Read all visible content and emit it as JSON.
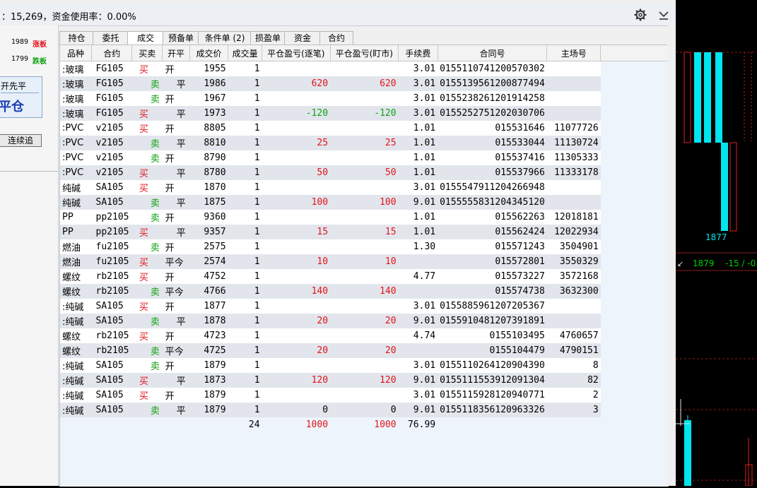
{
  "window": {
    "title": "：15,269，资金使用率：0.00%"
  },
  "chart": {
    "price_label": "1877",
    "last_price": "1879",
    "change": "-15 / -0."
  },
  "limits": {
    "up_value": "1989",
    "up_label": "涨板",
    "down_value": "1799",
    "down_label": "跌板"
  },
  "order_panel": {
    "close_first": "开先平",
    "close_position": "平仓",
    "continuous_chase": "连续追"
  },
  "tabs": [
    "持仓",
    "委托",
    "成交",
    "预备单",
    "条件单 (2)",
    "损盈单",
    "资金",
    "合约"
  ],
  "active_tab": "成交",
  "columns": [
    "品种",
    "合约",
    "买卖",
    "开平",
    "成交价",
    "成交量",
    "平仓盈亏(逐笔)",
    "平仓盈亏(盯市)",
    "手续费",
    "合同号",
    "主场号"
  ],
  "rows": [
    {
      "name": ":玻璃",
      "code": "FG105",
      "side": "买",
      "oc": "开",
      "price": "1955",
      "qty": "1",
      "pnl1": "",
      "pnl2": "",
      "fee": "3.01",
      "contract": "0155110741200570302",
      "exch": ""
    },
    {
      "name": ":玻璃",
      "code": "FG105",
      "side": "卖",
      "oc": "平",
      "price": "1986",
      "qty": "1",
      "pnl1": "620",
      "pnl2": "620",
      "fee": "3.01",
      "contract": "0155139561200877494",
      "exch": ""
    },
    {
      "name": ":玻璃",
      "code": "FG105",
      "side": "卖",
      "oc": "开",
      "price": "1967",
      "qty": "1",
      "pnl1": "",
      "pnl2": "",
      "fee": "3.01",
      "contract": "0155238261201914258",
      "exch": ""
    },
    {
      "name": ":玻璃",
      "code": "FG105",
      "side": "买",
      "oc": "平",
      "price": "1973",
      "qty": "1",
      "pnl1": "-120",
      "pnl2": "-120",
      "fee": "3.01",
      "contract": "0155252751202030706",
      "exch": ""
    },
    {
      "name": ":PVC",
      "code": "v2105",
      "side": "买",
      "oc": "开",
      "price": "8805",
      "qty": "1",
      "pnl1": "",
      "pnl2": "",
      "fee": "1.01",
      "contract": "015531646",
      "exch": "11077726"
    },
    {
      "name": ":PVC",
      "code": "v2105",
      "side": "卖",
      "oc": "平",
      "price": "8810",
      "qty": "1",
      "pnl1": "25",
      "pnl2": "25",
      "fee": "1.01",
      "contract": "015533044",
      "exch": "11130724"
    },
    {
      "name": ":PVC",
      "code": "v2105",
      "side": "卖",
      "oc": "开",
      "price": "8790",
      "qty": "1",
      "pnl1": "",
      "pnl2": "",
      "fee": "1.01",
      "contract": "015537416",
      "exch": "11305333"
    },
    {
      "name": ":PVC",
      "code": "v2105",
      "side": "买",
      "oc": "平",
      "price": "8780",
      "qty": "1",
      "pnl1": "50",
      "pnl2": "50",
      "fee": "1.01",
      "contract": "015537966",
      "exch": "11333178"
    },
    {
      "name": "纯碱",
      "code": "SA105",
      "side": "买",
      "oc": "开",
      "price": "1870",
      "qty": "1",
      "pnl1": "",
      "pnl2": "",
      "fee": "3.01",
      "contract": "0155547911204266948",
      "exch": ""
    },
    {
      "name": "纯碱",
      "code": "SA105",
      "side": "卖",
      "oc": "平",
      "price": "1875",
      "qty": "1",
      "pnl1": "100",
      "pnl2": "100",
      "fee": "9.01",
      "contract": "0155555831204345120",
      "exch": ""
    },
    {
      "name": "PP",
      "code": "pp2105",
      "side": "卖",
      "oc": "开",
      "price": "9360",
      "qty": "1",
      "pnl1": "",
      "pnl2": "",
      "fee": "1.01",
      "contract": "015562263",
      "exch": "12018181"
    },
    {
      "name": "PP",
      "code": "pp2105",
      "side": "买",
      "oc": "平",
      "price": "9357",
      "qty": "1",
      "pnl1": "15",
      "pnl2": "15",
      "fee": "1.01",
      "contract": "015562424",
      "exch": "12022934"
    },
    {
      "name": "燃油",
      "code": "fu2105",
      "side": "卖",
      "oc": "开",
      "price": "2575",
      "qty": "1",
      "pnl1": "",
      "pnl2": "",
      "fee": "1.30",
      "contract": "015571243",
      "exch": "3504901"
    },
    {
      "name": "燃油",
      "code": "fu2105",
      "side": "买",
      "oc": "平今",
      "price": "2574",
      "qty": "1",
      "pnl1": "10",
      "pnl2": "10",
      "fee": "",
      "contract": "015572801",
      "exch": "3550329"
    },
    {
      "name": "螺纹",
      "code": "rb2105",
      "side": "买",
      "oc": "开",
      "price": "4752",
      "qty": "1",
      "pnl1": "",
      "pnl2": "",
      "fee": "4.77",
      "contract": "015573227",
      "exch": "3572168"
    },
    {
      "name": "螺纹",
      "code": "rb2105",
      "side": "卖",
      "oc": "平今",
      "price": "4766",
      "qty": "1",
      "pnl1": "140",
      "pnl2": "140",
      "fee": "",
      "contract": "015574738",
      "exch": "3632300"
    },
    {
      "name": ":纯碱",
      "code": "SA105",
      "side": "买",
      "oc": "开",
      "price": "1877",
      "qty": "1",
      "pnl1": "",
      "pnl2": "",
      "fee": "3.01",
      "contract": "0155885961207205367",
      "exch": ""
    },
    {
      "name": ":纯碱",
      "code": "SA105",
      "side": "卖",
      "oc": "平",
      "price": "1878",
      "qty": "1",
      "pnl1": "20",
      "pnl2": "20",
      "fee": "9.01",
      "contract": "0155910481207391891",
      "exch": ""
    },
    {
      "name": "螺纹",
      "code": "rb2105",
      "side": "买",
      "oc": "开",
      "price": "4723",
      "qty": "1",
      "pnl1": "",
      "pnl2": "",
      "fee": "4.74",
      "contract": "0155103495",
      "exch": "4760657"
    },
    {
      "name": "螺纹",
      "code": "rb2105",
      "side": "卖",
      "oc": "平今",
      "price": "4725",
      "qty": "1",
      "pnl1": "20",
      "pnl2": "20",
      "fee": "",
      "contract": "0155104479",
      "exch": "4790151"
    },
    {
      "name": ":纯碱",
      "code": "SA105",
      "side": "卖",
      "oc": "开",
      "price": "1879",
      "qty": "1",
      "pnl1": "",
      "pnl2": "",
      "fee": "3.01",
      "contract": "0155110264120904390",
      "exch": "8"
    },
    {
      "name": ":纯碱",
      "code": "SA105",
      "side": "买",
      "oc": "平",
      "price": "1873",
      "qty": "1",
      "pnl1": "120",
      "pnl2": "120",
      "fee": "9.01",
      "contract": "0155111553912091304",
      "exch": "82"
    },
    {
      "name": ":纯碱",
      "code": "SA105",
      "side": "买",
      "oc": "开",
      "price": "1879",
      "qty": "1",
      "pnl1": "",
      "pnl2": "",
      "fee": "3.01",
      "contract": "0155115928120940771",
      "exch": "2"
    },
    {
      "name": ":纯碱",
      "code": "SA105",
      "side": "卖",
      "oc": "平",
      "price": "1879",
      "qty": "1",
      "pnl1": "0",
      "pnl2": "0",
      "fee": "9.01",
      "contract": "0155118356120963326",
      "exch": "3"
    }
  ],
  "summary": {
    "qty": "24",
    "pnl1": "1000",
    "pnl2": "1000",
    "fee": "76.99"
  },
  "colors": {
    "buy": "#e3121b",
    "sell": "#12a012",
    "candle_up": "#00e5ee",
    "candle_down": "#e02020"
  }
}
